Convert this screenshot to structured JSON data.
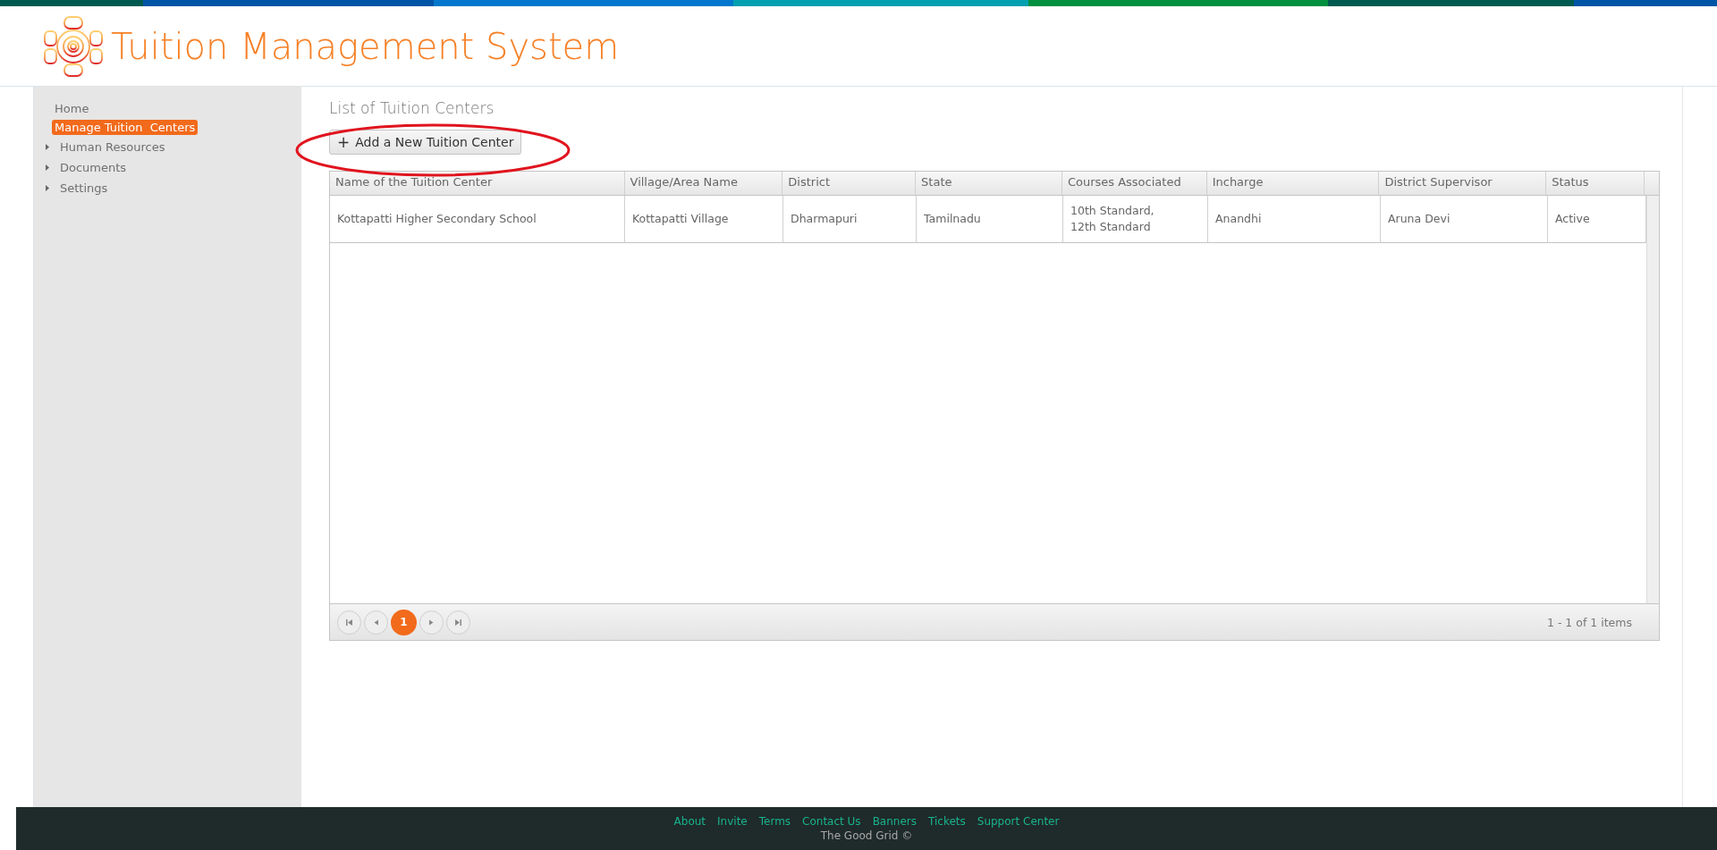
{
  "header": {
    "title": "Tuition Management System"
  },
  "sidebar": {
    "items": [
      {
        "label": "Home",
        "kind": "link",
        "selected": false
      },
      {
        "label": "Manage Tuition  Centers",
        "kind": "link",
        "selected": true
      },
      {
        "label": "Human Resources",
        "kind": "folder",
        "selected": false
      },
      {
        "label": "Documents",
        "kind": "folder",
        "selected": false
      },
      {
        "label": "Settings",
        "kind": "folder",
        "selected": false
      }
    ]
  },
  "page": {
    "title": "List of Tuition Centers",
    "add_button": {
      "icon": "+",
      "label": "Add a New Tuition Center",
      "highlighted": true
    }
  },
  "table": {
    "columns": [
      "Name of the Tuition Center",
      "Village/Area Name",
      "District",
      "State",
      "Courses Associated",
      "Incharge",
      "District Supervisor",
      "Status"
    ],
    "rows": [
      [
        "Kottapatti Higher Secondary School",
        "Kottapatti Village",
        "Dharmapuri",
        "Tamilnadu",
        "10th Standard,\n12th Standard",
        "Anandhi",
        "Aruna Devi",
        "Active"
      ]
    ]
  },
  "pager": {
    "pages": [
      {
        "label": "1",
        "selected": true
      }
    ],
    "info": "1 - 1 of 1 items"
  },
  "footer": {
    "links": [
      "About",
      "Invite",
      "Terms",
      "Contact Us",
      "Banners",
      "Tickets",
      "Support Center"
    ],
    "copyright": "The Good Grid ©"
  }
}
